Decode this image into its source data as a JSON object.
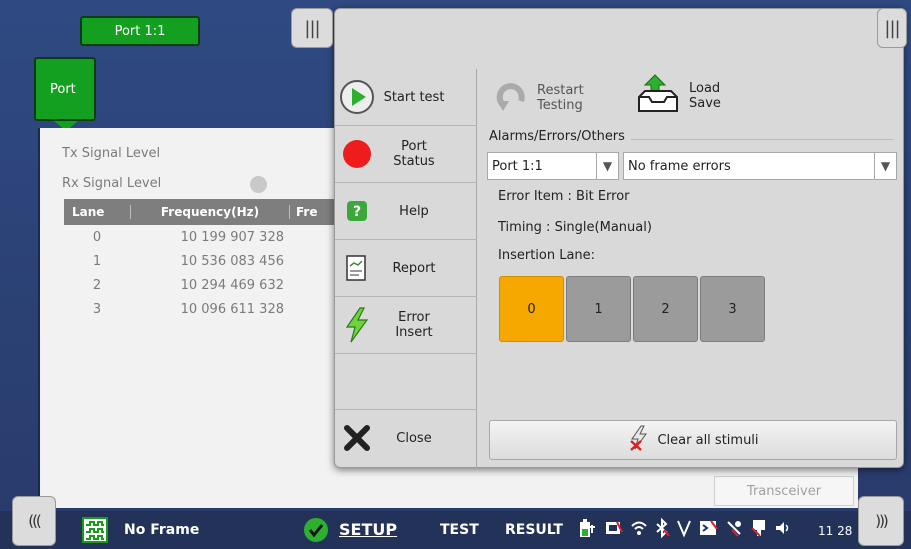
{
  "port_tab": {
    "label": "Port 1:1"
  },
  "side_tab": {
    "label": "Port"
  },
  "background": {
    "tx_label": "Tx Signal Level",
    "rx_label": "Rx Signal Level",
    "table": {
      "headers": [
        "Lane",
        "Frequency(Hz)",
        "Fre"
      ],
      "rows": [
        {
          "lane": "0",
          "freq": "10 199 907 328"
        },
        {
          "lane": "1",
          "freq": "10 536 083 456"
        },
        {
          "lane": "2",
          "freq": "10 294 469 632"
        },
        {
          "lane": "3",
          "freq": "10 096 611 328"
        }
      ]
    },
    "transceiver_tab": "Transceiver"
  },
  "menu": {
    "items": [
      {
        "label": "Start test",
        "icon": "play-icon"
      },
      {
        "label": "Port Status",
        "icon": "red-dot-icon"
      },
      {
        "label": "Help",
        "icon": "help-icon"
      },
      {
        "label": "Report",
        "icon": "report-icon"
      },
      {
        "label": "Error Insert",
        "icon": "lightning-icon"
      },
      {
        "label": "Close",
        "icon": "close-x-icon"
      }
    ]
  },
  "actions": {
    "restart_line1": "Restart",
    "restart_line2": "Testing",
    "load_line1": "Load",
    "load_line2": "Save"
  },
  "alarms": {
    "title": "Alarms/Errors/Others",
    "port_select": "Port 1:1",
    "error_select": "No frame errors",
    "error_item": "Error Item : Bit Error",
    "timing": "Timing : Single(Manual)",
    "insertion_lane_label": "Insertion Lane:",
    "lanes": [
      "0",
      "1",
      "2",
      "3"
    ],
    "selected_lane": "0"
  },
  "clear_button": "Clear all stimuli",
  "status_bar": {
    "frame_status": "No Frame",
    "nav_setup": "SETUP",
    "nav_test": "TEST",
    "nav_result": "RESULT",
    "time": "11 28"
  },
  "colors": {
    "accent_green": "#13a021",
    "lane_selected": "#f6a800",
    "status_bar": "#223259"
  }
}
